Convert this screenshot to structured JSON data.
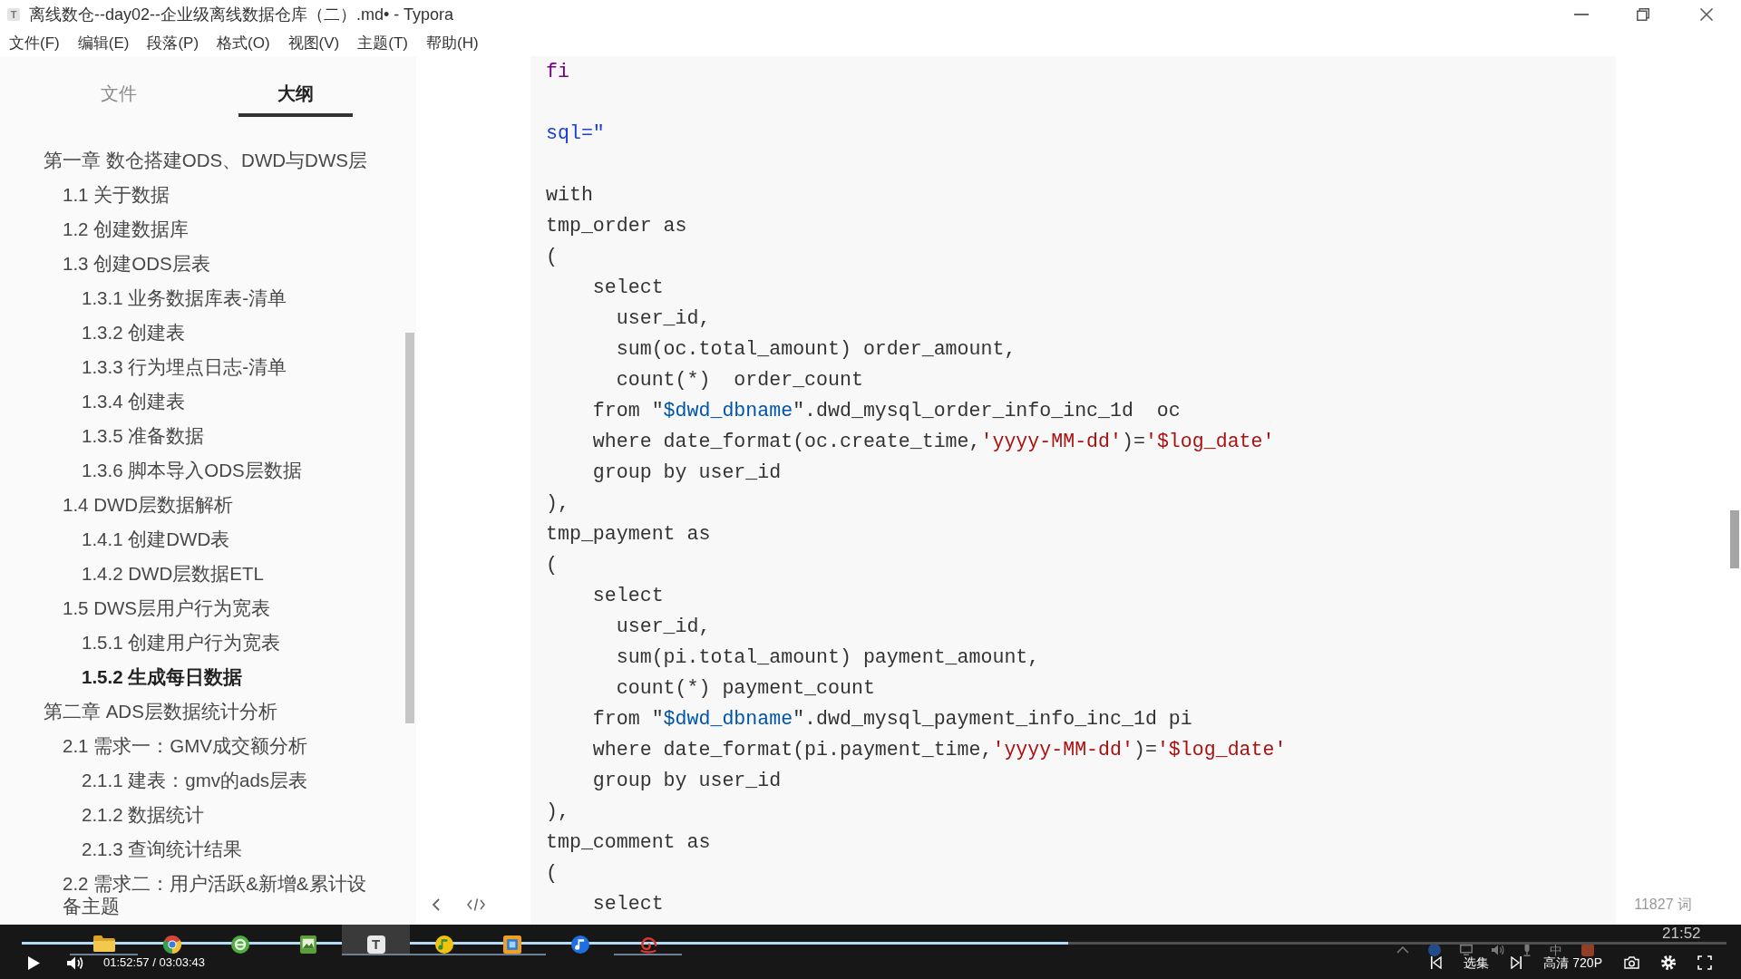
{
  "window": {
    "icon_letter": "T",
    "title": "离线数仓--day02--企业级离线数据仓库（二）.md• - Typora"
  },
  "menu": [
    "文件(F)",
    "编辑(E)",
    "段落(P)",
    "格式(O)",
    "视图(V)",
    "主题(T)",
    "帮助(H)"
  ],
  "sidebar": {
    "tabs": [
      {
        "label": "文件",
        "selected": false
      },
      {
        "label": "大纲",
        "selected": true
      }
    ],
    "outline": [
      {
        "label": "第一章 数仓搭建ODS、DWD与DWS层",
        "selected": false,
        "children": [
          {
            "label": "1.1 关于数据",
            "selected": false
          },
          {
            "label": "1.2 创建数据库",
            "selected": false
          },
          {
            "label": "1.3 创建ODS层表",
            "selected": false,
            "children": [
              {
                "label": "1.3.1 业务数据库表-清单",
                "selected": false
              },
              {
                "label": "1.3.2 创建表",
                "selected": false
              },
              {
                "label": "1.3.3 行为埋点日志-清单",
                "selected": false
              },
              {
                "label": "1.3.4 创建表",
                "selected": false
              },
              {
                "label": "1.3.5 准备数据",
                "selected": false
              },
              {
                "label": "1.3.6 脚本导入ODS层数据",
                "selected": false
              }
            ]
          },
          {
            "label": "1.4 DWD层数据解析",
            "selected": false,
            "children": [
              {
                "label": "1.4.1 创建DWD表",
                "selected": false
              },
              {
                "label": "1.4.2 DWD层数据ETL",
                "selected": false
              }
            ]
          },
          {
            "label": "1.5 DWS层用户行为宽表",
            "selected": false,
            "children": [
              {
                "label": "1.5.1 创建用户行为宽表",
                "selected": false
              },
              {
                "label": "1.5.2 生成每日数据",
                "selected": true
              }
            ]
          }
        ]
      },
      {
        "label": "第二章 ADS层数据统计分析",
        "selected": false,
        "children": [
          {
            "label": "2.1 需求一：GMV成交额分析",
            "selected": false,
            "children": [
              {
                "label": "2.1.1 建表：gmv的ads层表",
                "selected": false
              },
              {
                "label": "2.1.2 数据统计",
                "selected": false
              },
              {
                "label": "2.1.3 查询统计结果",
                "selected": false
              }
            ]
          },
          {
            "label": "2.2 需求二：用户活跃&新增&累计设备主题",
            "selected": false
          }
        ]
      }
    ]
  },
  "editor": {
    "code_lines": [
      {
        "kind": "code",
        "tokens": [
          {
            "text": "fi",
            "kind": "keyword"
          }
        ]
      },
      {
        "kind": "blank"
      },
      {
        "kind": "code",
        "tokens": [
          {
            "text": "sql=\"",
            "kind": "def"
          }
        ]
      },
      {
        "kind": "blank"
      },
      {
        "kind": "code",
        "tokens": [
          {
            "text": "with",
            "kind": "plain"
          }
        ]
      },
      {
        "kind": "code",
        "tokens": [
          {
            "text": "tmp_order as",
            "kind": "plain"
          }
        ]
      },
      {
        "kind": "code",
        "tokens": [
          {
            "text": "(",
            "kind": "plain"
          }
        ]
      },
      {
        "kind": "code",
        "tokens": [
          {
            "text": "    select",
            "kind": "plain"
          }
        ]
      },
      {
        "kind": "code",
        "tokens": [
          {
            "text": "      user_id,",
            "kind": "plain"
          }
        ]
      },
      {
        "kind": "code",
        "tokens": [
          {
            "text": "      sum(oc.total_amount) order_amount,",
            "kind": "plain"
          }
        ]
      },
      {
        "kind": "code",
        "tokens": [
          {
            "text": "      count(*)  order_count",
            "kind": "plain"
          }
        ]
      },
      {
        "kind": "code",
        "tokens": [
          {
            "text": "    from \"",
            "kind": "plain"
          },
          {
            "text": "$dwd_dbname",
            "kind": "variable"
          },
          {
            "text": "\".dwd_mysql_order_info_inc_1d  oc",
            "kind": "plain"
          }
        ]
      },
      {
        "kind": "code",
        "tokens": [
          {
            "text": "    where date_format(oc.create_time,",
            "kind": "plain"
          },
          {
            "text": "'yyyy-MM-dd'",
            "kind": "string"
          },
          {
            "text": ")=",
            "kind": "plain"
          },
          {
            "text": "'$log_date'",
            "kind": "string"
          }
        ]
      },
      {
        "kind": "code",
        "tokens": [
          {
            "text": "    group by user_id",
            "kind": "plain"
          }
        ]
      },
      {
        "kind": "code",
        "tokens": [
          {
            "text": "),",
            "kind": "plain"
          }
        ]
      },
      {
        "kind": "code",
        "tokens": [
          {
            "text": "tmp_payment as",
            "kind": "plain"
          }
        ]
      },
      {
        "kind": "code",
        "tokens": [
          {
            "text": "(",
            "kind": "plain"
          }
        ]
      },
      {
        "kind": "code",
        "tokens": [
          {
            "text": "    select",
            "kind": "plain"
          }
        ]
      },
      {
        "kind": "code",
        "tokens": [
          {
            "text": "      user_id,",
            "kind": "plain"
          }
        ]
      },
      {
        "kind": "code",
        "tokens": [
          {
            "text": "      sum(pi.total_amount) payment_amount,",
            "kind": "plain"
          }
        ]
      },
      {
        "kind": "code",
        "tokens": [
          {
            "text": "      count(*) payment_count",
            "kind": "plain"
          }
        ]
      },
      {
        "kind": "code",
        "tokens": [
          {
            "text": "    from \"",
            "kind": "plain"
          },
          {
            "text": "$dwd_dbname",
            "kind": "variable"
          },
          {
            "text": "\".dwd_mysql_payment_info_inc_1d pi",
            "kind": "plain"
          }
        ]
      },
      {
        "kind": "code",
        "tokens": [
          {
            "text": "    where date_format(pi.payment_time,",
            "kind": "plain"
          },
          {
            "text": "'yyyy-MM-dd'",
            "kind": "string"
          },
          {
            "text": ")=",
            "kind": "plain"
          },
          {
            "text": "'$log_date'",
            "kind": "string"
          }
        ]
      },
      {
        "kind": "code",
        "tokens": [
          {
            "text": "    group by user_id",
            "kind": "plain"
          }
        ]
      },
      {
        "kind": "code",
        "tokens": [
          {
            "text": "),",
            "kind": "plain"
          }
        ]
      },
      {
        "kind": "code",
        "tokens": [
          {
            "text": "tmp_comment as",
            "kind": "plain"
          }
        ]
      },
      {
        "kind": "code",
        "tokens": [
          {
            "text": "(",
            "kind": "plain"
          }
        ]
      },
      {
        "kind": "code",
        "tokens": [
          {
            "text": "    select",
            "kind": "plain"
          }
        ]
      }
    ],
    "word_count": "11827 词"
  },
  "taskbar": {
    "apps": [
      {
        "kind": "folder",
        "running": true,
        "selected": false
      },
      {
        "kind": "segmented-circle",
        "running": false,
        "selected": false
      },
      {
        "kind": "ring",
        "running": false,
        "selected": false
      },
      {
        "kind": "picture",
        "running": false,
        "selected": false
      },
      {
        "kind": "letter",
        "label": "T",
        "running": true,
        "selected": true
      },
      {
        "kind": "note-disc",
        "running": true,
        "selected": false
      },
      {
        "kind": "square-frame",
        "running": true,
        "selected": false
      },
      {
        "kind": "note-circle",
        "running": false,
        "selected": false
      },
      {
        "kind": "spiral",
        "running": true,
        "selected": false
      }
    ],
    "ime": "中",
    "clock": "21:52"
  },
  "player": {
    "progress": {
      "level": 0.614
    },
    "time": "01:52:57 / 03:03:43",
    "episodes": "选集",
    "quality": "高清 720P"
  }
}
